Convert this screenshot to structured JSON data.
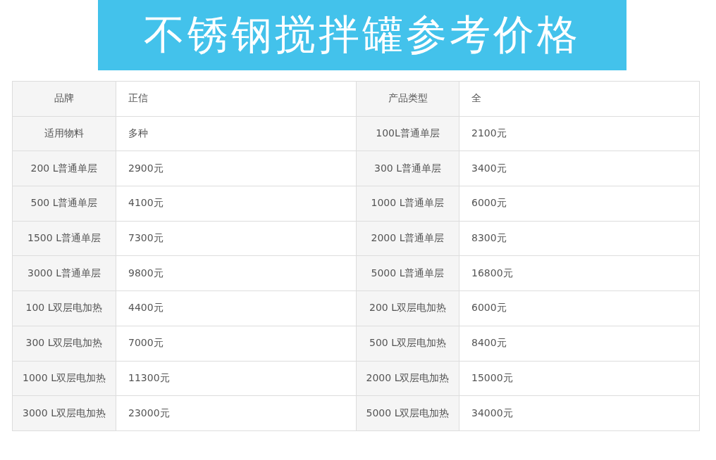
{
  "banner": {
    "title": "不锈钢搅拌罐参考价格"
  },
  "table": {
    "rows": [
      [
        {
          "label": "品牌",
          "value": "正信"
        },
        {
          "label": "产品类型",
          "value": "全"
        }
      ],
      [
        {
          "label": "适用物料",
          "value": "多种"
        },
        {
          "label": "100L普通单层",
          "value": "2100元"
        }
      ],
      [
        {
          "label": "200 L普通单层",
          "value": "2900元"
        },
        {
          "label": "300 L普通单层",
          "value": "3400元"
        }
      ],
      [
        {
          "label": "500 L普通单层",
          "value": "4100元"
        },
        {
          "label": "1000 L普通单层",
          "value": "6000元"
        }
      ],
      [
        {
          "label": "1500 L普通单层",
          "value": "7300元"
        },
        {
          "label": "2000 L普通单层",
          "value": "8300元"
        }
      ],
      [
        {
          "label": "3000 L普通单层",
          "value": "9800元"
        },
        {
          "label": "5000 L普通单层",
          "value": "16800元"
        }
      ],
      [
        {
          "label": "100 L双层电加热",
          "value": "4400元"
        },
        {
          "label": "200 L双层电加热",
          "value": "6000元"
        }
      ],
      [
        {
          "label": "300 L双层电加热",
          "value": "7000元"
        },
        {
          "label": "500 L双层电加热",
          "value": "8400元"
        }
      ],
      [
        {
          "label": "1000 L双层电加热",
          "value": "11300元"
        },
        {
          "label": "2000 L双层电加热",
          "value": "15000元"
        }
      ],
      [
        {
          "label": "3000 L双层电加热",
          "value": "23000元"
        },
        {
          "label": "5000 L双层电加热",
          "value": "34000元"
        }
      ]
    ]
  }
}
